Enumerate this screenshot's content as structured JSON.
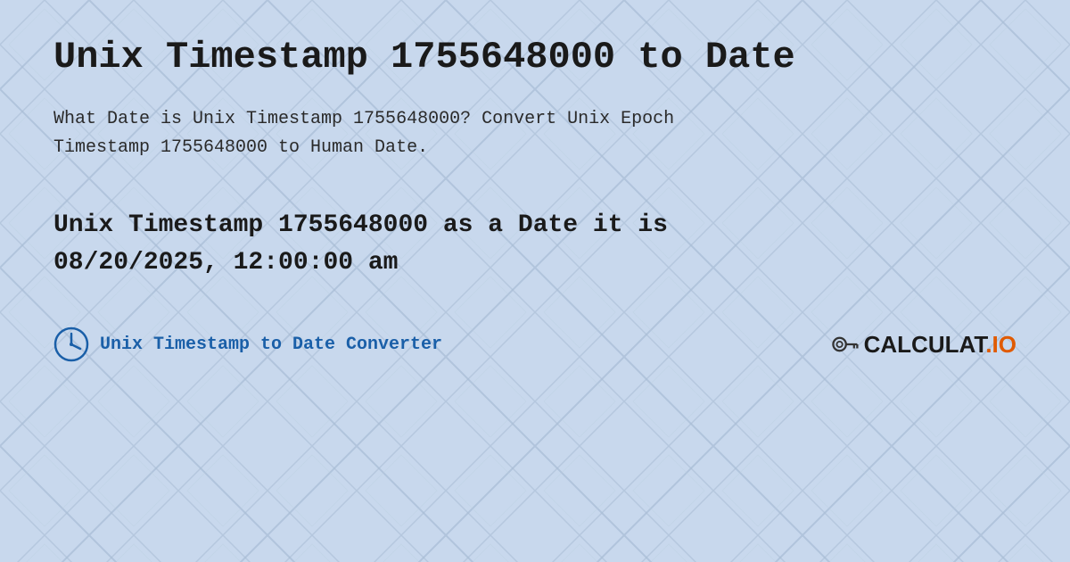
{
  "page": {
    "title": "Unix Timestamp 1755648000 to Date",
    "description_line1": "What Date is Unix Timestamp 1755648000? Convert Unix Epoch",
    "description_line2": "Timestamp 1755648000 to Human Date.",
    "result_line1": "Unix Timestamp 1755648000 as a Date it is",
    "result_line2": "08/20/2025, 12:00:00 am",
    "footer_link": "Unix Timestamp to Date Converter",
    "logo_text": "calculat.io",
    "bg_color": "#c8d8ed",
    "accent_color": "#1a5fa8"
  }
}
